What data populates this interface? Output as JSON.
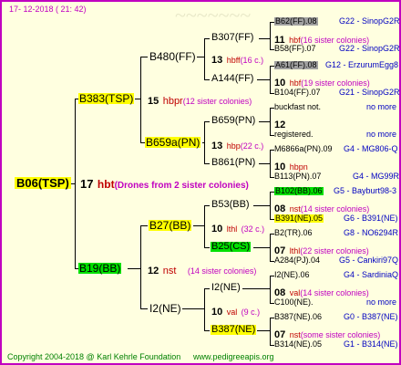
{
  "header": {
    "date": "17-  12-2018  (  21:  42)"
  },
  "footer": {
    "copyright": "Copyright 2004-2018 @ Karl Kehrle Foundation",
    "url": "www.pedigreeapis.org"
  },
  "root": {
    "name": "B06(TSP)",
    "num": "17",
    "abbr": "hbt",
    "sisters": "(Drones from 2 sister colonies)"
  },
  "gen1": [
    {
      "name": "B383(TSP)",
      "num": "15",
      "abbr": "hbpr",
      "sisters": "(12 sister colonies)"
    },
    {
      "name": "B19(BB)",
      "num": "12",
      "abbr": "nst",
      "sisters": "(14 sister colonies)"
    }
  ],
  "gen2": [
    {
      "name": "B480(FF)",
      "num": "13",
      "abbr": "hbff",
      "sisters": "(16 c.)"
    },
    {
      "name": "B659a(PN)",
      "num": "13",
      "abbr": "hbp",
      "sisters": "(22 c.)"
    },
    {
      "name": "B27(BB)",
      "num": "10",
      "abbr": "lthl",
      "sisters": "(32 c.)"
    },
    {
      "name": "I2(NE)",
      "num": "10",
      "abbr": "val",
      "sisters": "(9 c.)"
    }
  ],
  "gen3": [
    {
      "name": "B307(FF)",
      "num": "11",
      "abbr": "hbf",
      "sisters": "(16 sister colonies)",
      "top": "B62(FF).08",
      "top_right": "G22 - SinopG2R",
      "bottom": "B58(FF).07",
      "bottom_right": "G22 - SinopG2R"
    },
    {
      "name": "A144(FF)",
      "num": "10",
      "abbr": "hbf",
      "sisters": "(19 sister colonies)",
      "top": "A61(FF).08",
      "top_right": "G12 - ErzurumEgg8",
      "bottom": "B104(FF).07",
      "bottom_right": "G21 - SinopG2R"
    },
    {
      "name": "B659(PN)",
      "num": "12",
      "abbr": "",
      "sisters": "",
      "top": "buckfast not.",
      "top_right": "no more",
      "bottom": "registered.",
      "bottom_right": "no more"
    },
    {
      "name": "B861(PN)",
      "num": "10",
      "abbr": "hbpn",
      "sisters": "",
      "top": "M6866a(PN).09",
      "top_right": "G4 - MG806-Q",
      "bottom": "B113(PN).07",
      "bottom_right": "G4 - MG99R"
    },
    {
      "name": "B53(BB)",
      "num": "08",
      "abbr": "nst",
      "sisters": "(14 sister colonies)",
      "top": "B102(BB).06",
      "top_right": "G5 - Bayburt98-3",
      "bottom": "B391(NE).05",
      "bottom_right": "G6 - B391(NE)"
    },
    {
      "name": "B25(CS)",
      "num": "07",
      "abbr": "lthl",
      "sisters": "(22 sister colonies)",
      "top": "B2(TR).06",
      "top_right": "G8 - NO6294R",
      "bottom": "A284(PJ).04",
      "bottom_right": "G5 - Cankiri97Q"
    },
    {
      "name": "I2(NE)",
      "num": "08",
      "abbr": "val",
      "sisters": "(14 sister colonies)",
      "top": "I2(NE).06",
      "top_right": "G4 - SardiniaQ",
      "bottom": "C100(NE).",
      "bottom_right": "no more"
    },
    {
      "name": "B387(NE)",
      "num": "07",
      "abbr": "nst",
      "sisters": "(some sister colonies)",
      "top": "B387(NE).06",
      "top_right": "G0 - B387(NE)",
      "bottom": "B314(NE).05",
      "bottom_right": "G1 - B314(NE)"
    }
  ],
  "colors": {
    "border": "#c000c0",
    "bg": "#ffffe0",
    "highlight_yellow": "#ffff00",
    "highlight_green": "#00e000",
    "highlight_gray": "#a0a0a0",
    "abbr": "#c00000",
    "sisters": "#c000c0",
    "code": "#0000c0"
  }
}
